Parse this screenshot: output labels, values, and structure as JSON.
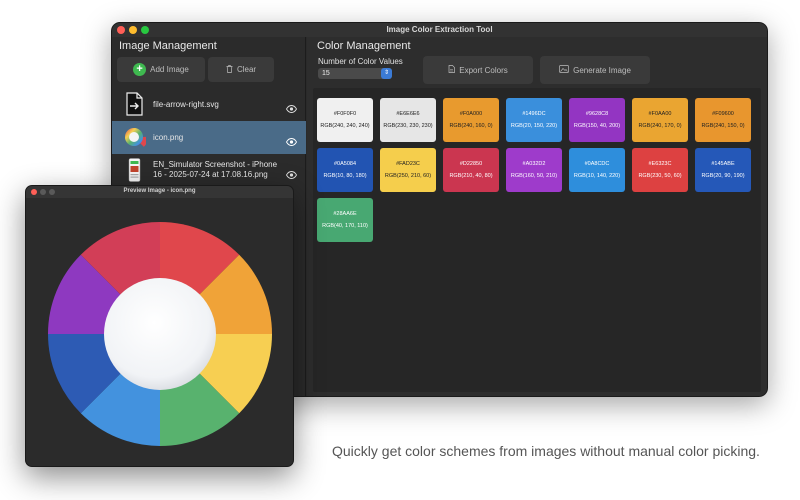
{
  "window": {
    "title": "Image Color Extraction Tool"
  },
  "left_pane": {
    "heading": "Image Management",
    "add_label": "Add Image",
    "clear_label": "Clear",
    "files": [
      {
        "name": "file-arrow-right.svg",
        "icon": "file-arrow-icon"
      },
      {
        "name": "icon.png",
        "icon": "color-wheel-thumb"
      },
      {
        "name": "EN_Simulator Screenshot - iPhone 16 - 2025-07-24 at 17.08.16.png",
        "icon": "screenshot-thumb"
      }
    ]
  },
  "right_pane": {
    "heading": "Color Management",
    "count_label": "Number of Color Values",
    "count_value": "15",
    "export_label": "Export Colors",
    "generate_label": "Generate Image"
  },
  "swatches": [
    {
      "hex": "#F0F0F0",
      "rgb": "RGB(240, 240, 240)",
      "color": "#F0F0F0",
      "text": "#222222"
    },
    {
      "hex": "#E6E6E6",
      "rgb": "RGB(230, 230, 230)",
      "color": "#E6E6E6",
      "text": "#222222"
    },
    {
      "hex": "#F0A000",
      "rgb": "RGB(240, 160, 0)",
      "color": "#E89A2E",
      "text": "#222222"
    },
    {
      "hex": "#1496DC",
      "rgb": "RGB(20, 150, 220)",
      "color": "#3A8FDC",
      "text": "#ffffff"
    },
    {
      "hex": "#9628C8",
      "rgb": "RGB(150, 40, 200)",
      "color": "#9335C2",
      "text": "#ffffff"
    },
    {
      "hex": "#F0AA00",
      "rgb": "RGB(240, 170, 0)",
      "color": "#EAA531",
      "text": "#222222"
    },
    {
      "hex": "#F09600",
      "rgb": "RGB(240, 150, 0)",
      "color": "#E8962E",
      "text": "#222222"
    },
    {
      "hex": "#0A5084",
      "rgb": "RGB(10, 80, 180)",
      "color": "#2254B2",
      "text": "#ffffff"
    },
    {
      "hex": "#FAD23C",
      "rgb": "RGB(250, 210, 60)",
      "color": "#F5CE4C",
      "text": "#222222"
    },
    {
      "hex": "#D22850",
      "rgb": "RGB(210, 40, 80)",
      "color": "#CB3650",
      "text": "#ffffff"
    },
    {
      "hex": "#A032D2",
      "rgb": "RGB(160, 50, 210)",
      "color": "#9E3BCB",
      "text": "#ffffff"
    },
    {
      "hex": "#0A8CDC",
      "rgb": "RGB(10, 140, 220)",
      "color": "#2E8EDC",
      "text": "#ffffff"
    },
    {
      "hex": "#E6323C",
      "rgb": "RGB(230, 50, 60)",
      "color": "#DD4141",
      "text": "#ffffff"
    },
    {
      "hex": "#145ABE",
      "rgb": "RGB(20, 90, 190)",
      "color": "#2558B8",
      "text": "#ffffff"
    },
    {
      "hex": "#28AA6E",
      "rgb": "RGB(40, 170, 110)",
      "color": "#48A872",
      "text": "#ffffff"
    }
  ],
  "preview": {
    "title": "Preview Image - icon.png",
    "wheel_colors": [
      "#E0474C",
      "#F0A338",
      "#F7CF52",
      "#58B26E",
      "#4392DE",
      "#2D5BB4",
      "#8E39C0",
      "#D23E57"
    ]
  },
  "tagline": "Quickly get color schemes from images without manual color picking."
}
